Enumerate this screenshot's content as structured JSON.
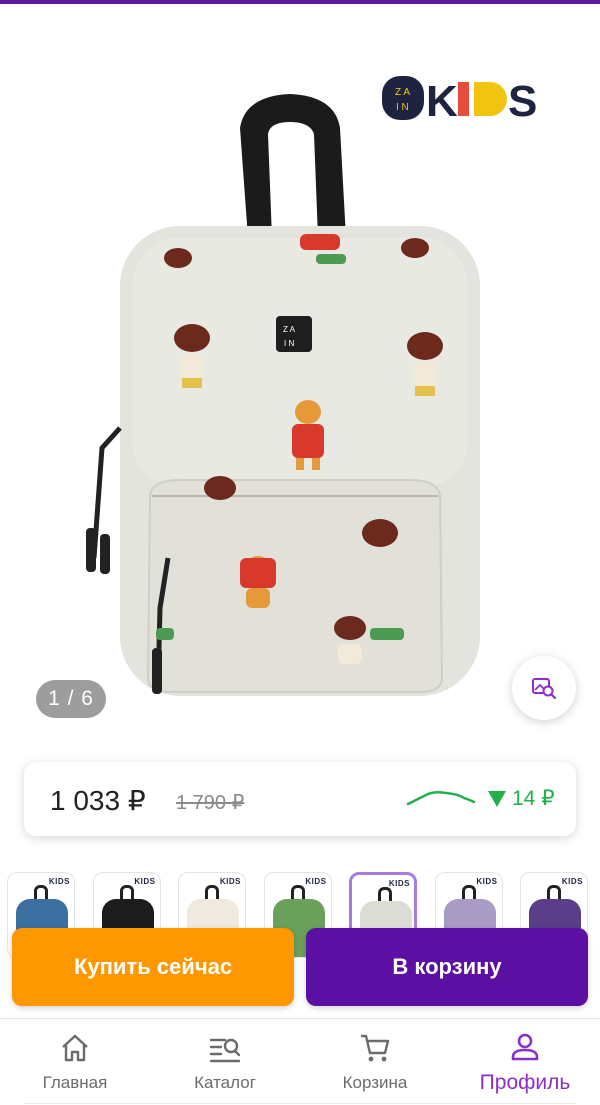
{
  "colors": {
    "accent_purple": "#5b0fa3",
    "buy_orange": "#ff9800",
    "price_down_green": "#21b14b",
    "active_nav": "#8b2fc9"
  },
  "product": {
    "brand": "ZAIN KIDS",
    "image_counter": "1 / 6",
    "visual_search_icon": "image-search-icon"
  },
  "price": {
    "current": "1 033 ₽",
    "old": "1 790 ₽",
    "change": "14 ₽",
    "trend": "down"
  },
  "thumbnails": [
    {
      "id": "thumb-1",
      "color": "#3a6fa0",
      "selected": false
    },
    {
      "id": "thumb-2",
      "color": "#1c1c1c",
      "selected": false
    },
    {
      "id": "thumb-3",
      "color": "#efe9e0",
      "selected": false
    },
    {
      "id": "thumb-4",
      "color": "#6aa05a",
      "selected": false
    },
    {
      "id": "thumb-5",
      "color": "#dcdcd6",
      "selected": true
    },
    {
      "id": "thumb-6",
      "color": "#a89bc4",
      "selected": false
    },
    {
      "id": "thumb-7",
      "color": "#5a3e8a",
      "selected": false
    }
  ],
  "actions": {
    "buy_now": "Купить сейчас",
    "add_to_cart": "В корзину"
  },
  "nav": {
    "items": [
      {
        "label": "Главная",
        "icon": "home-icon",
        "active": false
      },
      {
        "label": "Каталог",
        "icon": "catalog-search-icon",
        "active": false
      },
      {
        "label": "Корзина",
        "icon": "cart-icon",
        "active": false
      },
      {
        "label": "Профиль",
        "icon": "profile-icon",
        "active": true
      }
    ]
  }
}
